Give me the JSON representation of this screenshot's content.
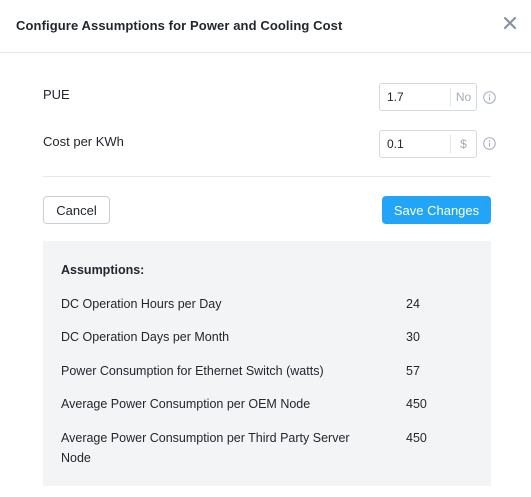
{
  "dialog": {
    "title": "Configure Assumptions for Power and Cooling Cost"
  },
  "fields": [
    {
      "label": "PUE",
      "value": "1.7",
      "unit": "No"
    },
    {
      "label": "Cost per KWh",
      "value": "0.1",
      "unit": "$"
    }
  ],
  "buttons": {
    "cancel_label": "Cancel",
    "save_label": "Save Changes"
  },
  "assumptions": {
    "title": "Assumptions:",
    "rows": [
      {
        "label": "DC Operation Hours per Day",
        "value": "24"
      },
      {
        "label": "DC Operation Days per Month",
        "value": "30"
      },
      {
        "label": "Power Consumption for Ethernet Switch (watts)",
        "value": "57"
      },
      {
        "label": "Average Power Consumption per OEM Node",
        "value": "450"
      },
      {
        "label": "Average Power Consumption per Third Party Server Node",
        "value": "450"
      }
    ]
  },
  "colors": {
    "primary": "#22a5f7",
    "panel_bg": "#f3f4f6",
    "border": "#d3d8de"
  },
  "icons": {
    "close": "close-icon",
    "info": "info-icon"
  }
}
